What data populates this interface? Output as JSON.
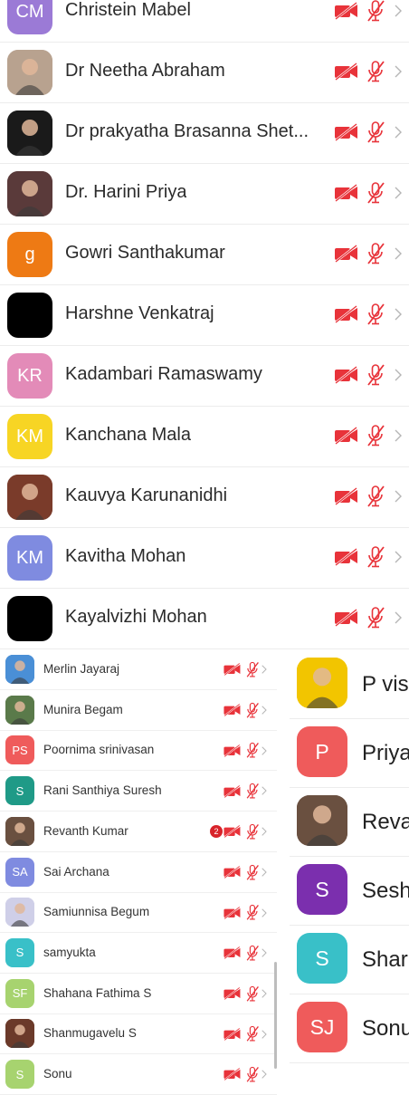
{
  "top_list": [
    {
      "initials": "CM",
      "name": "Christein Mabel",
      "avatar_color": "#9b7ad6",
      "avatar_type": "initials"
    },
    {
      "initials": "",
      "name": "Dr Neetha Abraham",
      "avatar_color": "#b8a28f",
      "avatar_type": "photo"
    },
    {
      "initials": "",
      "name": "Dr prakyatha Brasanna Shet...",
      "avatar_color": "#1a1a1a",
      "avatar_type": "photo"
    },
    {
      "initials": "",
      "name": "Dr. Harini Priya",
      "avatar_color": "#5a3a3a",
      "avatar_type": "photo"
    },
    {
      "initials": "g",
      "name": "Gowri Santhakumar",
      "avatar_color": "#ee7a14",
      "avatar_type": "initials"
    },
    {
      "initials": "",
      "name": "Harshne Venkatraj",
      "avatar_color": "#000000",
      "avatar_type": "initials"
    },
    {
      "initials": "KR",
      "name": "Kadambari Ramaswamy",
      "avatar_color": "#e38bb8",
      "avatar_type": "initials"
    },
    {
      "initials": "KM",
      "name": "Kanchana Mala",
      "avatar_color": "#f7d524",
      "avatar_type": "initials"
    },
    {
      "initials": "",
      "name": "Kauvya Karunanidhi",
      "avatar_color": "#7a3b2a",
      "avatar_type": "photo"
    },
    {
      "initials": "KM",
      "name": "Kavitha Mohan",
      "avatar_color": "#7f8be0",
      "avatar_type": "initials"
    },
    {
      "initials": "",
      "name": "Kayalvizhi Mohan",
      "avatar_color": "#000000",
      "avatar_type": "initials"
    }
  ],
  "small_list": [
    {
      "initials": "",
      "name": "Merlin Jayaraj",
      "avatar_color": "#4a8fd6",
      "avatar_type": "photo",
      "badge": ""
    },
    {
      "initials": "",
      "name": "Munira Begam",
      "avatar_color": "#5a7a4a",
      "avatar_type": "photo",
      "badge": ""
    },
    {
      "initials": "PS",
      "name": "Poornima srinivasan",
      "avatar_color": "#ef5b5b",
      "avatar_type": "initials",
      "badge": ""
    },
    {
      "initials": "S",
      "name": "Rani Santhiya Suresh",
      "avatar_color": "#1f9a87",
      "avatar_type": "initials",
      "badge": ""
    },
    {
      "initials": "",
      "name": "Revanth Kumar",
      "avatar_color": "#6a5040",
      "avatar_type": "photo",
      "badge": "2"
    },
    {
      "initials": "SA",
      "name": "Sai Archana",
      "avatar_color": "#7f8be0",
      "avatar_type": "initials",
      "badge": ""
    },
    {
      "initials": "",
      "name": "Samiunnisa Begum",
      "avatar_color": "#cfcfe8",
      "avatar_type": "photo",
      "badge": ""
    },
    {
      "initials": "S",
      "name": "samyukta",
      "avatar_color": "#39c0c8",
      "avatar_type": "initials",
      "badge": ""
    },
    {
      "initials": "SF",
      "name": "Shahana Fathima S",
      "avatar_color": "#a7d36f",
      "avatar_type": "initials",
      "badge": ""
    },
    {
      "initials": "",
      "name": "Shanmugavelu S",
      "avatar_color": "#6b3a2a",
      "avatar_type": "photo",
      "badge": ""
    },
    {
      "initials": "S",
      "name": "Sonu",
      "avatar_color": "#a7d36f",
      "avatar_type": "initials",
      "badge": ""
    }
  ],
  "right_list": [
    {
      "initials": "",
      "name": "P vis",
      "avatar_color": "#f2c500",
      "avatar_type": "photo"
    },
    {
      "initials": "P",
      "name": "Priya",
      "avatar_color": "#ef5b5b",
      "avatar_type": "initials"
    },
    {
      "initials": "",
      "name": "Reva",
      "avatar_color": "#6a5040",
      "avatar_type": "photo"
    },
    {
      "initials": "S",
      "name": "Sesh",
      "avatar_color": "#7b2fae",
      "avatar_type": "initials"
    },
    {
      "initials": "S",
      "name": "Shar",
      "avatar_color": "#39c0c8",
      "avatar_type": "initials"
    },
    {
      "initials": "SJ",
      "name": "Sonu",
      "avatar_color": "#ef5b5b",
      "avatar_type": "initials"
    }
  ],
  "colors": {
    "muted_red": "#e8333a",
    "chevron": "#b5b5b5"
  },
  "icons": {
    "video": "video-off-icon",
    "mic": "mic-off-icon",
    "chevron": "chevron-right-icon"
  }
}
